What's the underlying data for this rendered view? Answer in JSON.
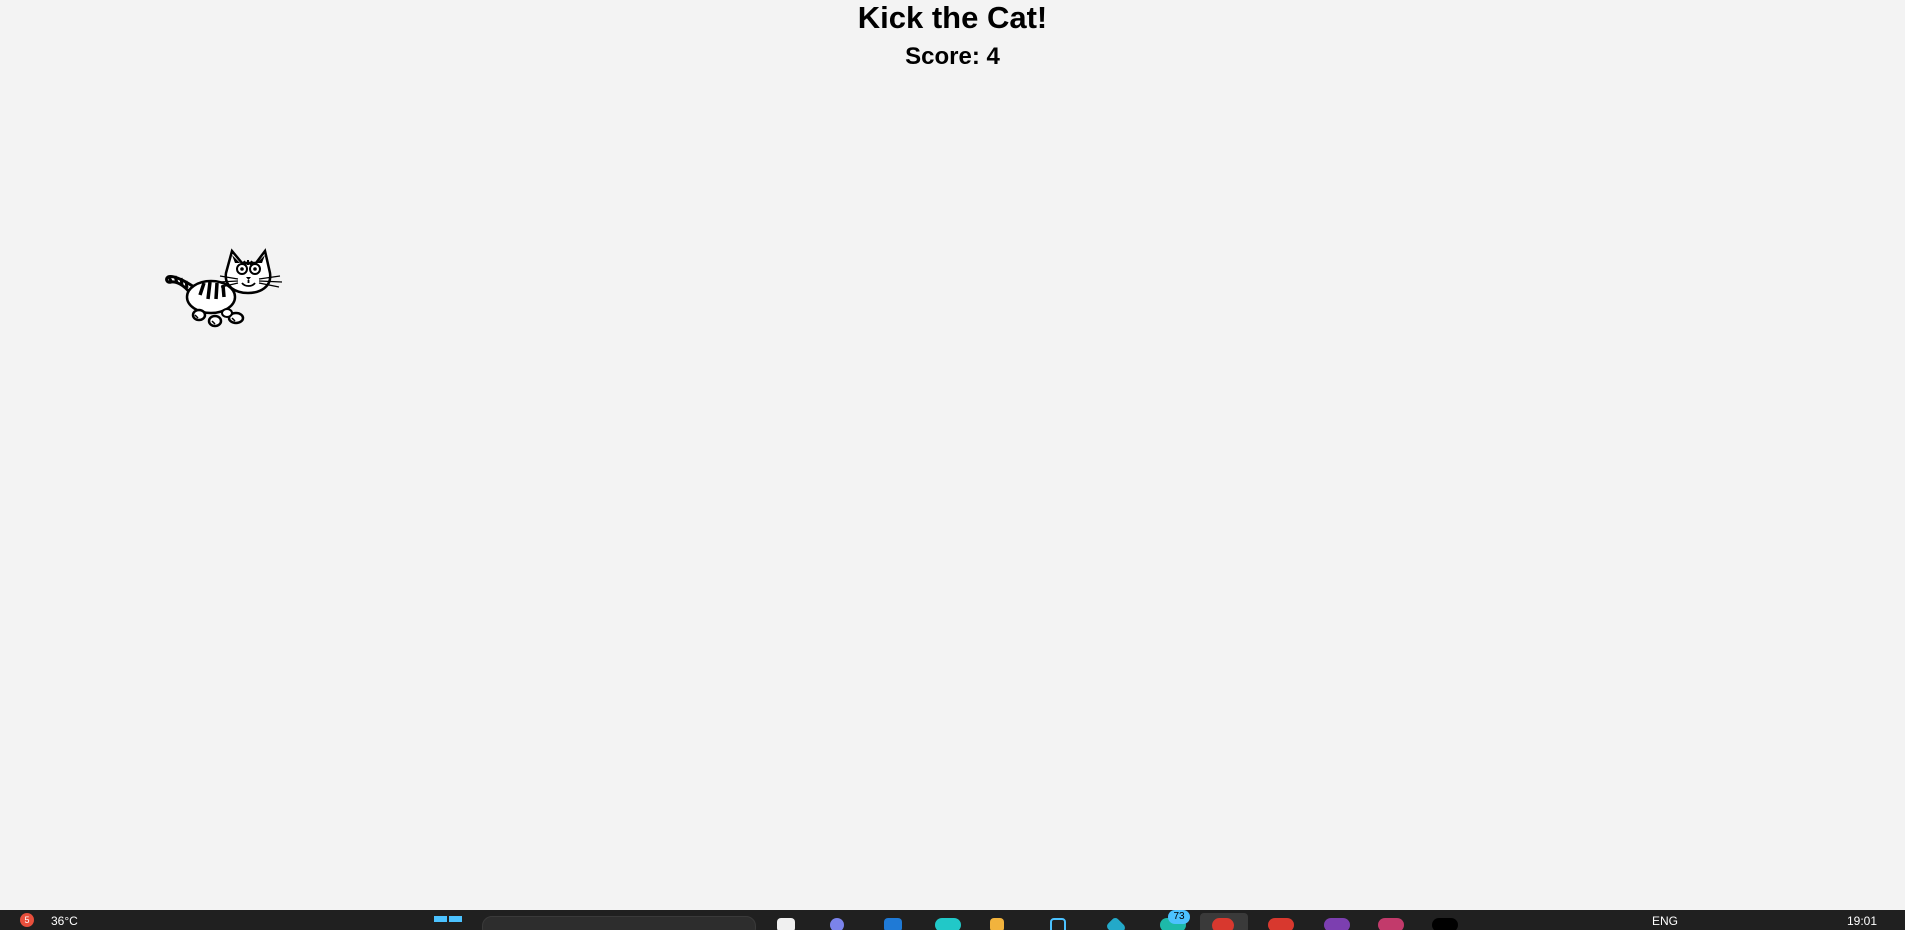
{
  "game": {
    "title": "Kick the Cat!",
    "score_text": "Score: 4"
  },
  "cat": {
    "icon": "cat-icon"
  },
  "taskbar": {
    "weather_badge": "5",
    "weather_temp": "36°C",
    "app_badge": "73",
    "language": "ENG",
    "clock": "19:01",
    "colors": {
      "background": "#202020",
      "accent": "#4cc2ff"
    }
  },
  "colors": {
    "page_background": "#f3f3f3",
    "text": "#000000"
  }
}
